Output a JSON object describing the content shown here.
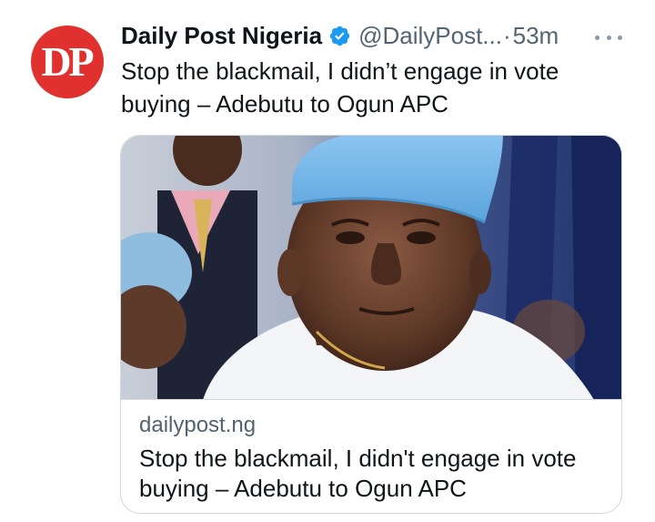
{
  "tweet": {
    "author": {
      "avatar_text": "DP",
      "display_name": "Daily Post Nigeria",
      "handle": "@DailyPost...",
      "verified_icon": "verified-badge-icon",
      "avatar_color": "#e0312f"
    },
    "separator": "·",
    "timestamp": "53m",
    "text": "Stop the blackmail, I didn’t engage in vote buying – Adebutu to Ogun APC",
    "more_icon": "more-options-icon",
    "accent_color": "#1d9bf0"
  },
  "link_card": {
    "domain": "dailypost.ng",
    "title": "Stop the blackmail, I didn't engage in vote buying – Adebutu to Ogun APC",
    "image_icon": "article-photo-image"
  }
}
